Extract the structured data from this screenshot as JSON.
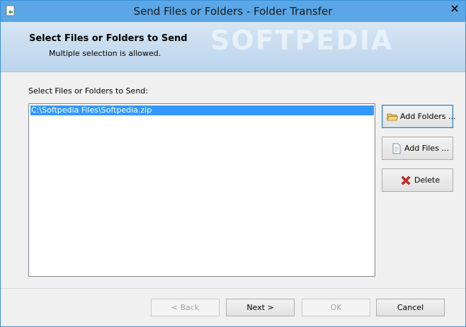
{
  "window": {
    "title": "Send Files or Folders - Folder Transfer"
  },
  "header": {
    "title": "Select Files or Folders to Send",
    "subtitle": "Multiple selection is allowed.",
    "watermark": "SOFTPEDIA"
  },
  "main": {
    "list_label": "Select Files or Folders to Send:",
    "items": [
      "C:\\Softpedia Files\\Softpedia.zip"
    ]
  },
  "side_buttons": {
    "add_folders": {
      "label": "Add Folders ...",
      "icon": "folder-icon"
    },
    "add_files": {
      "label": "Add Files ...",
      "icon": "file-icon"
    },
    "delete": {
      "label": "Delete",
      "icon": "delete-icon"
    }
  },
  "footer": {
    "back": "< Back",
    "next": "Next >",
    "ok": "OK",
    "cancel": "Cancel"
  },
  "colors": {
    "titlebar": "#5aa6e6",
    "selection": "#3399ff",
    "header_band": "#c6dbef"
  }
}
